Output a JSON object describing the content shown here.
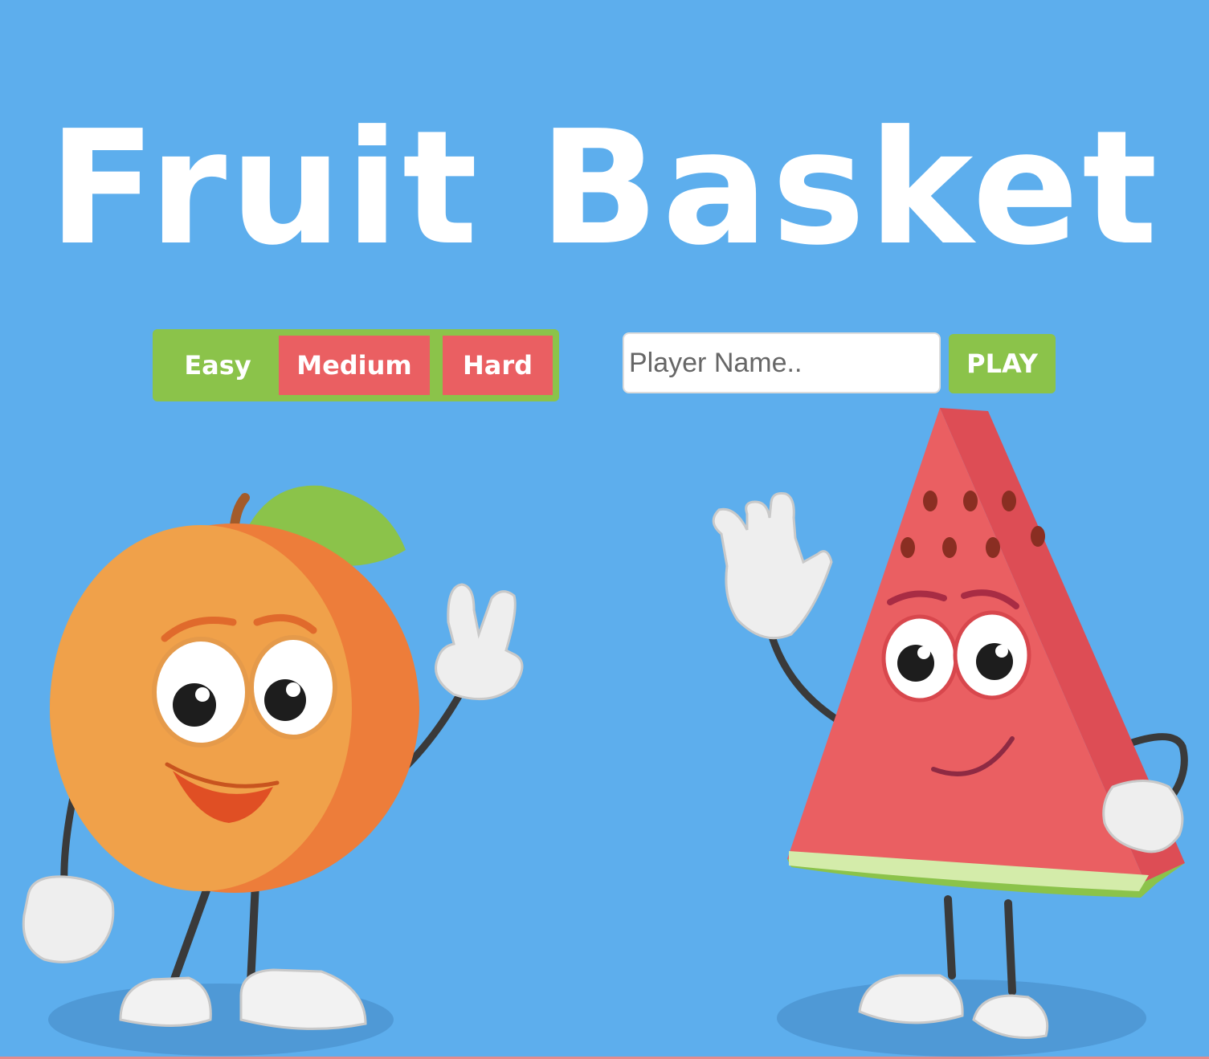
{
  "game": {
    "title": "Fruit Basket"
  },
  "difficulty": {
    "options": [
      "Easy",
      "Medium",
      "Hard"
    ],
    "selected": "Easy"
  },
  "player": {
    "name_placeholder": "Player Name..",
    "name_value": "",
    "play_label": "PLAY"
  },
  "colors": {
    "background": "#5daeed",
    "selected_difficulty": "#8bc34a",
    "unselected_difficulty": "#ea5f62",
    "play_button": "#8bc34a",
    "title_text": "#ffffff"
  },
  "characters": [
    {
      "name": "orange-character-illustration",
      "icon": "orange-mascot"
    },
    {
      "name": "watermelon-character-illustration",
      "icon": "watermelon-mascot"
    }
  ]
}
